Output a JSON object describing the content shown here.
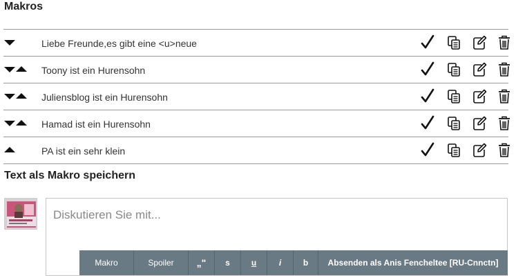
{
  "title": "Makros",
  "macros": [
    {
      "text": "Liebe Freunde,es gibt eine <u>neue",
      "arrows": [
        "down"
      ]
    },
    {
      "text": "Toony ist ein Hurensohn",
      "arrows": [
        "down",
        "up"
      ]
    },
    {
      "text": "Juliensblog ist ein Hurensohn",
      "arrows": [
        "down",
        "up"
      ]
    },
    {
      "text": "Hamad ist ein Hurensohn",
      "arrows": [
        "down",
        "up"
      ]
    },
    {
      "text": "PA ist ein sehr klein",
      "arrows": [
        "up"
      ]
    }
  ],
  "action_icons": [
    "checkmark-icon",
    "copy-icon",
    "edit-icon",
    "trash-icon"
  ],
  "save_heading": "Text als Makro speichern",
  "editor": {
    "placeholder": "Diskutieren Sie mit..."
  },
  "toolbar": {
    "makro": "Makro",
    "spoiler": "Spoiler",
    "quote": "„\"",
    "strike": "s",
    "underline": "u",
    "italic": "i",
    "bold": "b",
    "send": "Absenden als Anis Fencheltee [RU-Cnnctn]"
  },
  "colors": {
    "toolbar_bg": "#6a7a84",
    "divider": "#999999"
  }
}
